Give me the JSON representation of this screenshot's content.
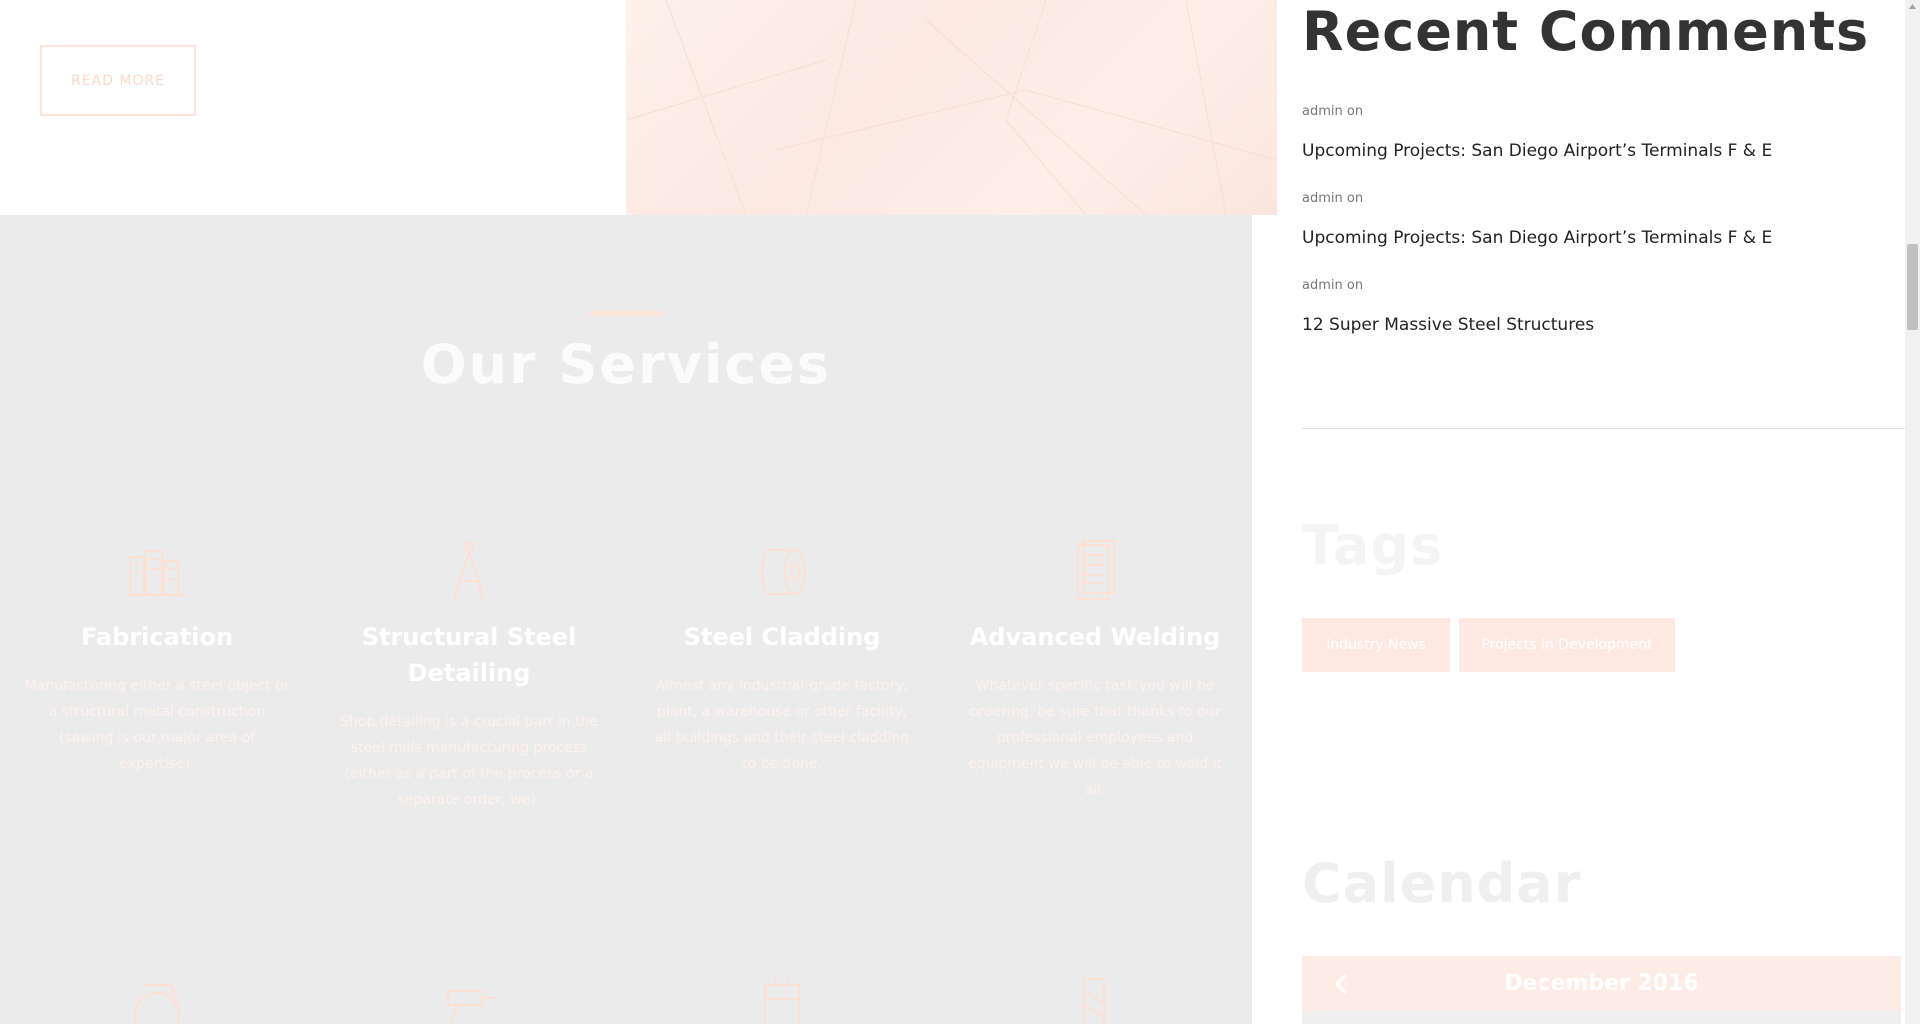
{
  "hero": {
    "read_more_label": "READ MORE"
  },
  "services": {
    "title": "Our Services",
    "items": [
      {
        "icon": "building-icon",
        "title": "Fabrication",
        "text": "Manufacturing either a steel object or a structural metal construction (sawing is our major area of expertise)."
      },
      {
        "icon": "compass-icon",
        "title": "Structural Steel Detailing",
        "text": "Shop detailing is a crucial part in the steel mills manufacturing process (either as a part of the process or a separate order, we)."
      },
      {
        "icon": "steel-roll-icon",
        "title": "Steel Cladding",
        "text": "Almost any industrial-grade factory, plant, a warehouse or other facility, all buildings and their steel cladding to be done."
      },
      {
        "icon": "cabinet-icon",
        "title": "Advanced Welding",
        "text": "Whatever specific task you will be ordering, be sure that thanks to our professional employees and equipment we will be able to weld it all."
      }
    ],
    "more_icons": [
      "saw-icon",
      "drill-icon",
      "machine-icon",
      "column-icon"
    ]
  },
  "sidebar": {
    "recent_comments_title": "Recent Comments",
    "comments": [
      {
        "author": "admin on",
        "post": "Upcoming Projects: San Diego Airport’s Terminals F & E"
      },
      {
        "author": "admin on",
        "post": "Upcoming Projects: San Diego Airport’s Terminals F & E"
      },
      {
        "author": "admin on",
        "post": "12 Super Massive Steel Structures"
      }
    ],
    "tags_title": "Tags",
    "tags": [
      "Industry News",
      "Projects in Development"
    ],
    "calendar_title": "Calendar",
    "calendar_month": "December 2016"
  },
  "colors": {
    "accent": "#fde3d8",
    "services_bg": "#ebebeb"
  }
}
